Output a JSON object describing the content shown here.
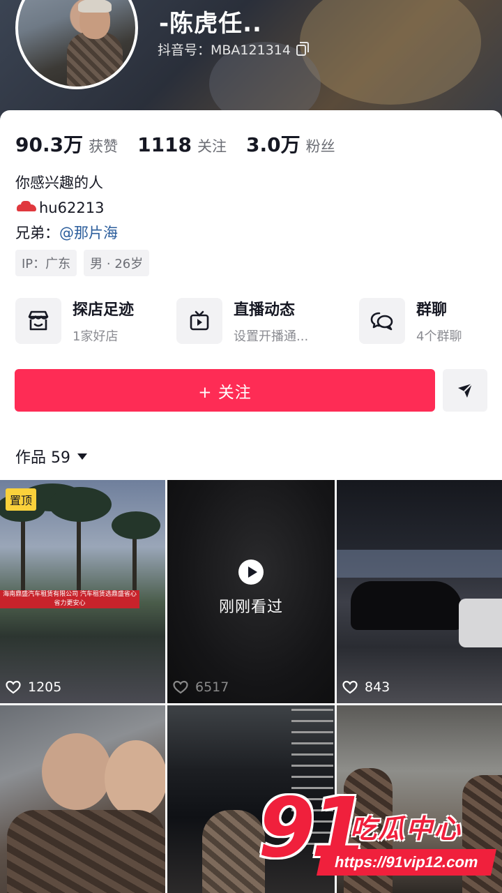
{
  "profile": {
    "nickname": "-陈虎任..",
    "douyin_id": "抖音号：MBA121314",
    "stats": [
      {
        "value": "90.3万",
        "label": "获赞"
      },
      {
        "value": "1118",
        "label": "关注"
      },
      {
        "value": "3.0万",
        "label": "粉丝"
      }
    ],
    "bio_line1": "你感兴趣的人",
    "bio_line2": "hu62213",
    "bio_line3_prefix": "兄弟：",
    "bio_line3_link": "@那片海",
    "tags": [
      "IP：广东",
      "男 · 26岁"
    ]
  },
  "entries": [
    {
      "title": "探店足迹",
      "subtitle": "1家好店",
      "icon": "shop-icon"
    },
    {
      "title": "直播动态",
      "subtitle": "设置开播通...",
      "icon": "tv-icon"
    },
    {
      "title": "群聊",
      "subtitle": "4个群聊",
      "icon": "chat-icon"
    }
  ],
  "actions": {
    "follow_label": "+ 关注",
    "share_icon": "send-icon"
  },
  "works": {
    "label": "作品 59",
    "tiles": [
      {
        "likes": "1205",
        "pinned_label": "置顶"
      },
      {
        "likes": "6517",
        "overlay_text": "刚刚看过"
      },
      {
        "likes": "843"
      },
      {
        "likes": ""
      },
      {
        "likes": ""
      },
      {
        "likes": ""
      }
    ]
  },
  "banner_text": "海南鼎盛汽车租赁有限公司 汽车租赁选鼎盛省心省力更安心",
  "watermark": {
    "number": "91",
    "brand": "吃瓜中心",
    "url": "https://91vip12.com"
  },
  "colors": {
    "accent": "#fe2c55",
    "link": "#2b5d9b",
    "pin": "#fad13b",
    "watermark": "#f0203c"
  }
}
